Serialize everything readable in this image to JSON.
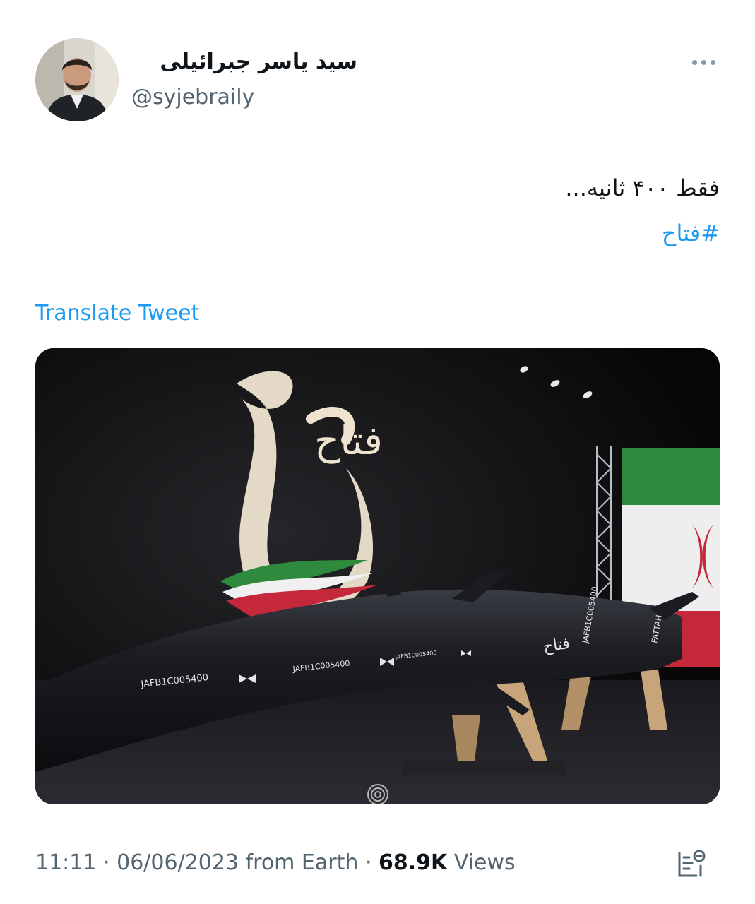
{
  "tweet": {
    "author": {
      "display_name": "سید یاسر جبرائیلی",
      "handle": "@syjebraily",
      "avatar_icon": "profile-photo"
    },
    "text": "فقط ۴۰۰ ثانیه...",
    "hashtag": "#فتاح",
    "translate_label": "Translate Tweet",
    "media": {
      "logo_text": "فتاح",
      "missile_codes": [
        "JAFB1C005400",
        "JAFB1C005400",
        "JAFB1C005400",
        "JAFB1C005400"
      ],
      "missile_name": "فتاح",
      "nose_label": "FATTAH"
    },
    "meta": {
      "time": "11:11",
      "separator": "·",
      "date": "06/06/2023",
      "source": "from Earth",
      "views_count": "68.9K",
      "views_label": "Views"
    },
    "icons": {
      "more": "more-horizontal-icon",
      "analytics": "analytics-icon"
    },
    "colors": {
      "link": "#1d9bf0",
      "secondary_text": "#536471",
      "primary_text": "#0f1419"
    }
  }
}
